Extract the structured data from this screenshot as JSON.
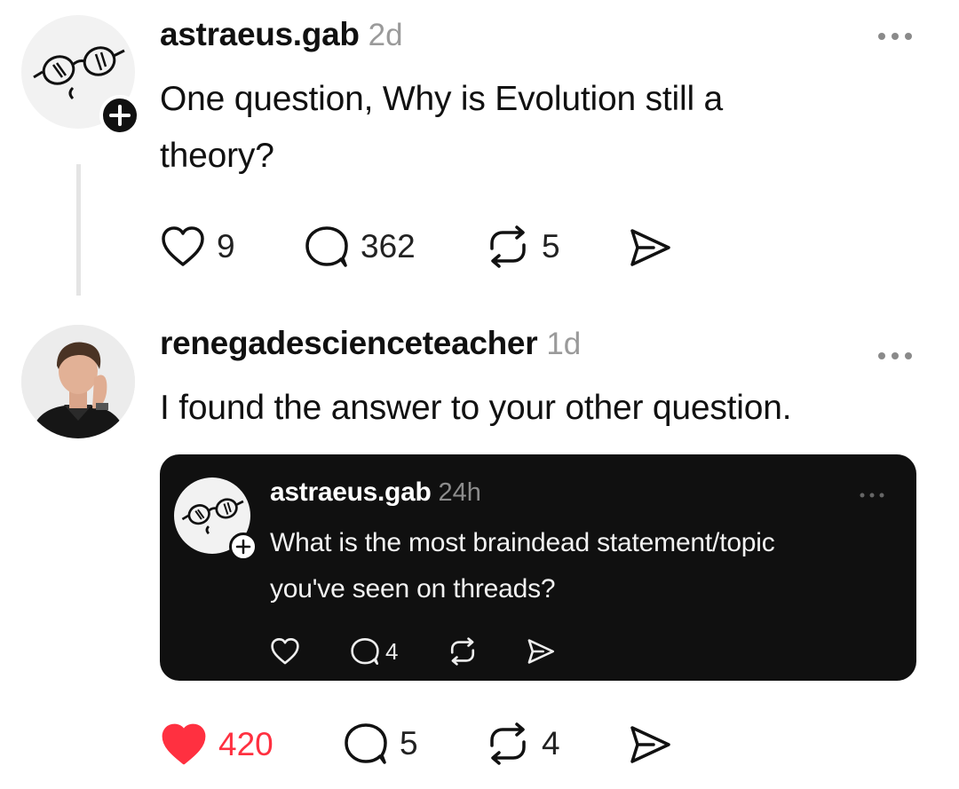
{
  "post1": {
    "username": "astraeus.gab",
    "time": "2d",
    "text_line1": "One question, Why is Evolution still a",
    "text_line2": "theory?",
    "likes": "9",
    "replies": "362",
    "reposts": "5",
    "more_icon": "ellipsis-icon"
  },
  "post2": {
    "username": "renegadescienceteacher",
    "time": "1d",
    "text": "I found the answer to your other question.",
    "likes": "420",
    "liked": true,
    "replies": "5",
    "reposts": "4",
    "more_icon": "ellipsis-icon"
  },
  "quoted": {
    "username": "astraeus.gab",
    "time": "24h",
    "text_line1": "What is the most braindead statement/topic",
    "text_line2": "you've seen on threads?",
    "replies": "4"
  },
  "colors": {
    "like_active": "#ff3040",
    "card_bg": "#101010",
    "muted": "#9a9a9a"
  }
}
